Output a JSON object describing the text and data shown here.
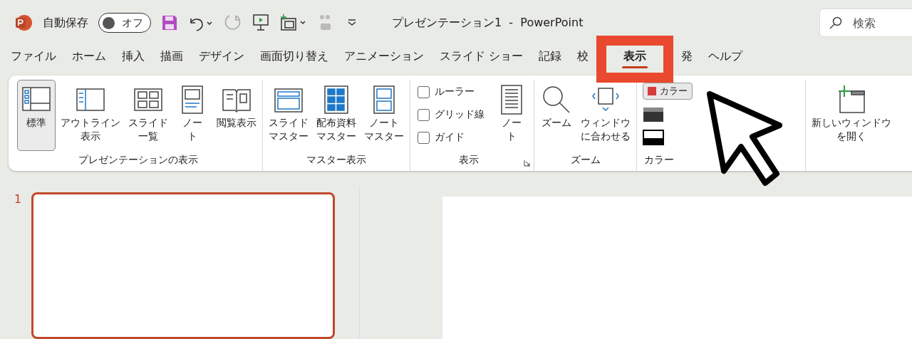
{
  "title_bar": {
    "autosave_label": "自動保存",
    "autosave_toggle": {
      "label": "オフ",
      "on": false
    },
    "document_title": "プレゼンテーション1  -  PowerPoint",
    "search": {
      "placeholder": "検索"
    }
  },
  "tabs": [
    {
      "label": "ファイル",
      "selected": false
    },
    {
      "label": "ホーム",
      "selected": false
    },
    {
      "label": "挿入",
      "selected": false
    },
    {
      "label": "描画",
      "selected": false
    },
    {
      "label": "デザイン",
      "selected": false
    },
    {
      "label": "画面切り替え",
      "selected": false
    },
    {
      "label": "アニメーション",
      "selected": false
    },
    {
      "label": "スライド ショー",
      "selected": false
    },
    {
      "label": "記録",
      "selected": false
    },
    {
      "label": "校",
      "selected": false
    },
    {
      "label": "表示",
      "selected": true
    },
    {
      "label": "発",
      "selected": false
    },
    {
      "label": "ヘルプ",
      "selected": false
    }
  ],
  "ribbon": {
    "groups": [
      {
        "label": "プレゼンテーションの表示",
        "launcher": false,
        "items": [
          {
            "kind": "large",
            "lines": [
              "標準"
            ],
            "selected": true
          },
          {
            "kind": "large",
            "lines": [
              "アウトライン",
              "表示"
            ],
            "selected": false
          },
          {
            "kind": "large",
            "lines": [
              "スライド",
              "一覧"
            ],
            "selected": false
          },
          {
            "kind": "large",
            "lines": [
              "ノー",
              "ト"
            ],
            "selected": false
          },
          {
            "kind": "large",
            "lines": [
              "閲覧表示"
            ],
            "selected": false
          }
        ]
      },
      {
        "label": "マスター表示",
        "launcher": false,
        "items": [
          {
            "kind": "large",
            "lines": [
              "スライド",
              "マスター"
            ],
            "selected": false
          },
          {
            "kind": "large",
            "lines": [
              "配布資料",
              "マスター"
            ],
            "selected": false
          },
          {
            "kind": "large",
            "lines": [
              "ノート",
              "マスター"
            ],
            "selected": false
          }
        ]
      },
      {
        "label": "表示",
        "launcher": true,
        "items": [
          {
            "kind": "checks",
            "checks": [
              {
                "label": "ルーラー",
                "checked": false
              },
              {
                "label": "グリッド線",
                "checked": false
              },
              {
                "label": "ガイド",
                "checked": false
              }
            ]
          },
          {
            "kind": "large",
            "lines": [
              "ノー",
              "ト"
            ],
            "selected": false
          }
        ]
      },
      {
        "label": "ズーム",
        "launcher": false,
        "items": [
          {
            "kind": "large",
            "lines": [
              "ズーム"
            ],
            "selected": false
          },
          {
            "kind": "large",
            "lines": [
              "ウィンドウ",
              "に合わせる"
            ],
            "selected": false
          }
        ]
      },
      {
        "label": "カラー",
        "launcher": false,
        "items": [
          {
            "kind": "color",
            "label": "カラー",
            "selected": true
          }
        ]
      },
      {
        "items": [
          {
            "kind": "large",
            "lines": [
              "新しいウィンドウ",
              "を開く"
            ],
            "selected": false
          }
        ]
      }
    ]
  },
  "slides": [
    {
      "number": "1",
      "selected": true
    }
  ]
}
